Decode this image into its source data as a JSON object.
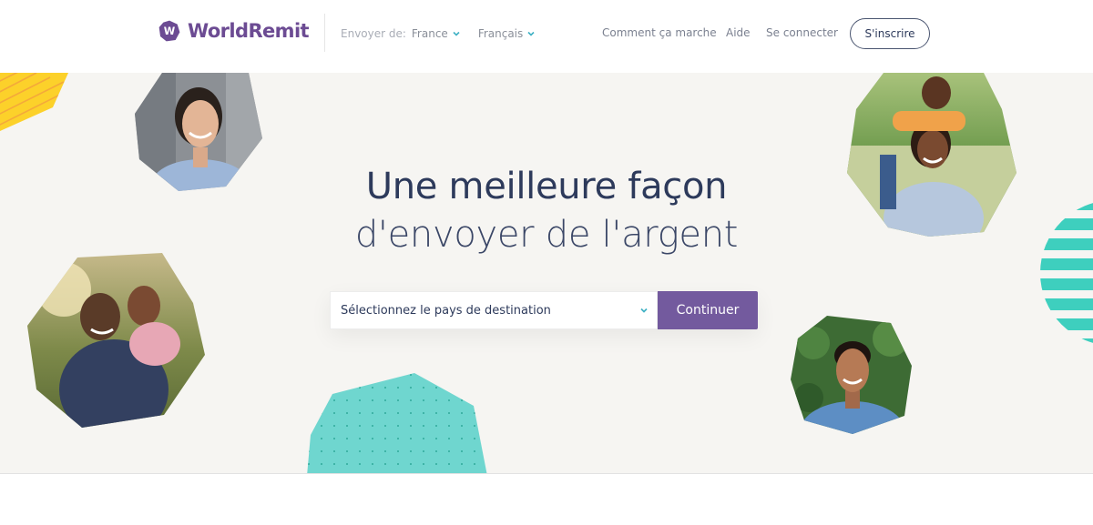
{
  "brand": {
    "name": "WorldRemit",
    "logo_letter": "W",
    "color": "#6c4b93"
  },
  "header": {
    "send_from_label": "Envoyer de:",
    "country": "France",
    "language": "Français",
    "nav": {
      "how_it_works": "Comment ça marche",
      "help": "Aide",
      "login": "Se connecter"
    },
    "signup": "S'inscrire"
  },
  "hero": {
    "title_line1": "Une meilleure façon",
    "title_line2": "d'envoyer de l'argent",
    "destination_placeholder": "Sélectionnez le pays de destination",
    "continue": "Continuer",
    "background": "#f6f5f2"
  },
  "icons": {
    "dropdown": "chevron-down-icon"
  },
  "colors": {
    "accent": "#735a9e",
    "teal": "#3ecfbe",
    "yellow": "#fcd12a",
    "chevron": "#3fb1c4",
    "heading": "#2d3a5b"
  }
}
